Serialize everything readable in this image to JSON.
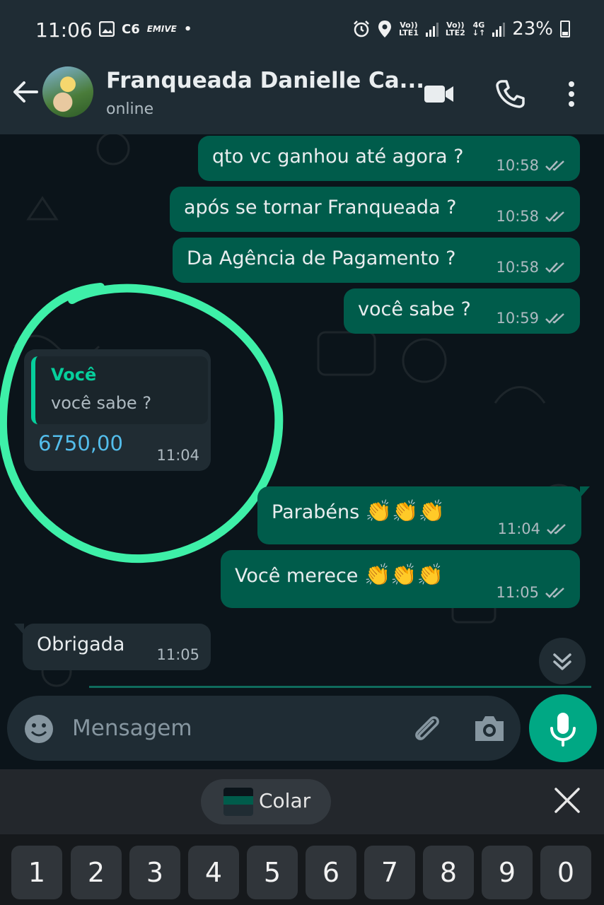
{
  "status_bar": {
    "time": "11:06",
    "icons_left": [
      "image-icon",
      "c6-icon",
      "emive-icon",
      "dot"
    ],
    "c6_text": "C6",
    "emive_text": "EMIVE",
    "dot": "•",
    "sim1": {
      "top": "Vo))",
      "bottom": "LTE1"
    },
    "sim2": {
      "top": "Vo))",
      "bottom": "LTE2"
    },
    "network": "4G",
    "battery": "23%"
  },
  "header": {
    "contact_name": "Franqueada Danielle Ca...",
    "status": "online"
  },
  "messages": [
    {
      "type": "out",
      "text": "qto vc ganhou até agora ?",
      "time": "10:58"
    },
    {
      "type": "out",
      "text": "após se tornar Franqueada ?",
      "time": "10:58"
    },
    {
      "type": "out",
      "text": "Da Agência de Pagamento ?",
      "time": "10:58"
    },
    {
      "type": "out",
      "text": "você sabe ?",
      "time": "10:59"
    },
    {
      "type": "in_reply",
      "quote_author": "Você",
      "quote_text": "você sabe ?",
      "text": "6750,00",
      "time": "11:04"
    },
    {
      "type": "out",
      "text": "Parabéns",
      "emoji": "👏👏👏",
      "time": "11:04"
    },
    {
      "type": "out",
      "text": "Você merece",
      "emoji": "👏👏👏",
      "time": "11:05"
    },
    {
      "type": "in",
      "text": "Obrigada",
      "time": "11:05"
    }
  ],
  "composer": {
    "placeholder": "Mensagem"
  },
  "keyboard": {
    "paste_label": "Colar",
    "number_row": [
      "1",
      "2",
      "3",
      "4",
      "5",
      "6",
      "7",
      "8",
      "9",
      "0"
    ]
  },
  "colors": {
    "outgoing_bubble": "#005c4b",
    "incoming_bubble": "#202c33",
    "accent": "#00a884",
    "highlight_circle": "#3ef0a8"
  }
}
